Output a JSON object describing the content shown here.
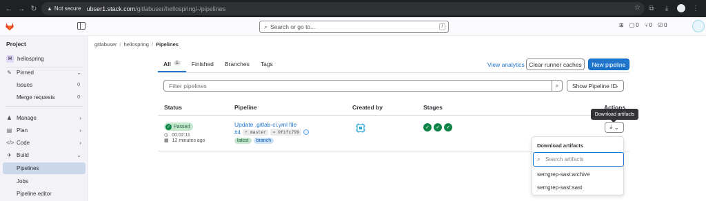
{
  "browser": {
    "security_label": "Not secure",
    "url_host": "ubser1.stack.com",
    "url_path": "/gitlabuser/hellospring/-/pipelines"
  },
  "topbar": {
    "search_placeholder": "Search or go to...",
    "search_shortcut": "/",
    "issues_count": "0",
    "mr_count": "0",
    "todo_count": "0"
  },
  "sidebar": {
    "title": "Project",
    "project_initial": "H",
    "project_name": "hellospring",
    "pinned": "Pinned",
    "issues": "Issues",
    "issues_count": "0",
    "merge_requests": "Merge requests",
    "merge_requests_count": "0",
    "manage": "Manage",
    "plan": "Plan",
    "code": "Code",
    "build": "Build",
    "pipelines": "Pipelines",
    "jobs": "Jobs",
    "pipeline_editor": "Pipeline editor"
  },
  "breadcrumb": [
    "gitlabuser",
    "hellospring",
    "Pipelines"
  ],
  "tabs": {
    "all": "All",
    "all_count": "1",
    "finished": "Finished",
    "branches": "Branches",
    "tags": "Tags"
  },
  "actions": {
    "view_analytics": "View analytics",
    "clear_cache": "Clear runner caches",
    "new_pipeline": "New pipeline"
  },
  "filter": {
    "placeholder": "Filter pipelines",
    "sort_label": "Show Pipeline ID"
  },
  "table": {
    "headers": {
      "status": "Status",
      "pipeline": "Pipeline",
      "created_by": "Created by",
      "stages": "Stages",
      "actions": "Actions"
    },
    "row": {
      "status": "Passed",
      "duration": "00:02:11",
      "time_ago": "12 minutes ago",
      "title": "Update .gitlab-ci.yml file",
      "id": "#4",
      "branch": "master",
      "commit": "0f1fc799",
      "tag_latest": "latest",
      "tag_branch": "branch",
      "stage_count": 3
    }
  },
  "tooltip": "Download artifacts",
  "artifacts_dropdown": {
    "title": "Download artifacts",
    "search_placeholder": "Search artifacts",
    "items": [
      "semgrep-sast:archive",
      "semgrep-sast:sast"
    ]
  },
  "colors": {
    "accent": "#1f75cb",
    "success": "#108548",
    "browser_dark": "#202124"
  }
}
